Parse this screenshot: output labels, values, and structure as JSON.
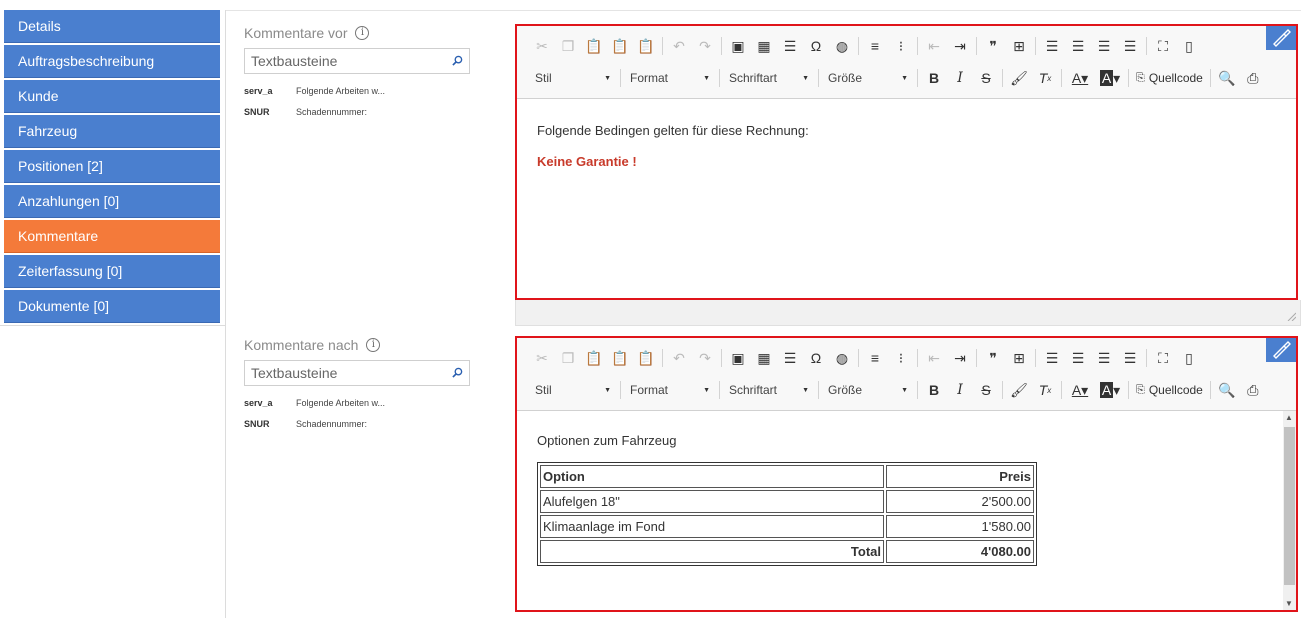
{
  "sidebar": {
    "items": [
      {
        "label": "Details"
      },
      {
        "label": "Auftragsbeschreibung"
      },
      {
        "label": "Kunde"
      },
      {
        "label": "Fahrzeug"
      },
      {
        "label": "Positionen [2]"
      },
      {
        "label": "Anzahlungen [0]"
      },
      {
        "label": "Kommentare"
      },
      {
        "label": "Zeiterfassung [0]"
      },
      {
        "label": "Dokumente [0]"
      }
    ],
    "active_index": 6
  },
  "colors": {
    "nav": "#4a7fcf",
    "nav_active": "#f47a3a",
    "editor_border": "#e0141a",
    "warning_text": "#c83a2a"
  },
  "before": {
    "label": "Kommentare vor",
    "search_placeholder": "Textbausteine",
    "snippets": [
      {
        "code": "serv_a",
        "desc": "Folgende Arbeiten w..."
      },
      {
        "code": "SNUR",
        "desc": "Schadennummer:"
      }
    ],
    "editor": {
      "line1": "Folgende Bedingen gelten für diese Rechnung:",
      "line2": "Keine Garantie !"
    }
  },
  "after": {
    "label": "Kommentare nach",
    "search_placeholder": "Textbausteine",
    "snippets": [
      {
        "code": "serv_a",
        "desc": "Folgende Arbeiten w..."
      },
      {
        "code": "SNUR",
        "desc": "Schadennummer:"
      }
    ],
    "editor": {
      "intro": "Optionen zum Fahrzeug",
      "table": {
        "headers": [
          "Option",
          "Preis"
        ],
        "rows": [
          [
            "Alufelgen 18\"",
            "2'500.00"
          ],
          [
            "Klimaanlage im Fond",
            "1'580.00"
          ]
        ],
        "total_label": "Total",
        "total_value": "4'080.00"
      }
    }
  },
  "toolbar": {
    "combos": [
      "Stil",
      "Format",
      "Schriftart",
      "Größe"
    ],
    "source_label": "Quellcode"
  }
}
